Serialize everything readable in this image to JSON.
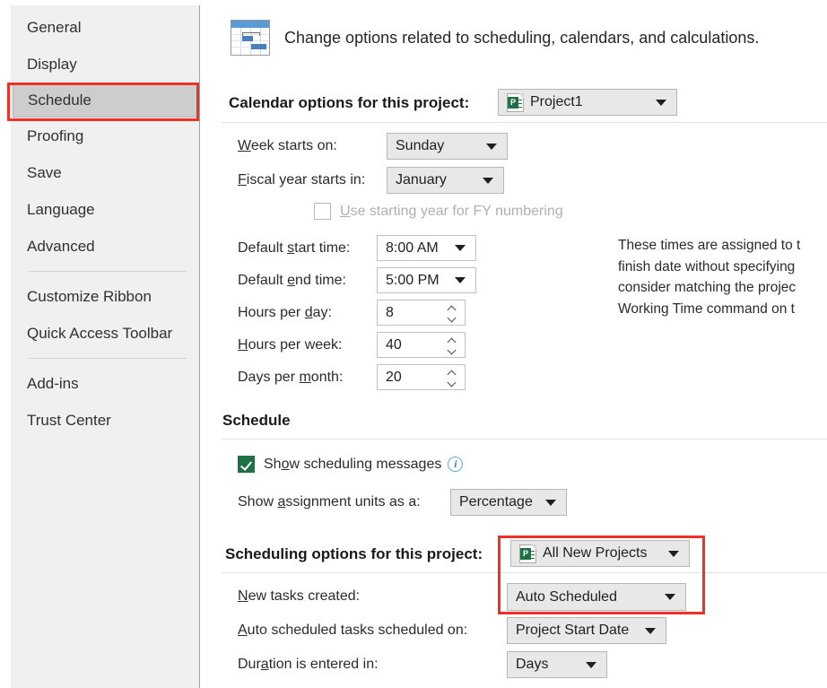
{
  "sidebar": {
    "items": [
      {
        "label": "General",
        "selected": false,
        "divider_after": false
      },
      {
        "label": "Display",
        "selected": false,
        "divider_after": false
      },
      {
        "label": "Schedule",
        "selected": true,
        "divider_after": false
      },
      {
        "label": "Proofing",
        "selected": false,
        "divider_after": false
      },
      {
        "label": "Save",
        "selected": false,
        "divider_after": false
      },
      {
        "label": "Language",
        "selected": false,
        "divider_after": false
      },
      {
        "label": "Advanced",
        "selected": false,
        "divider_after": true
      },
      {
        "label": "Customize Ribbon",
        "selected": false,
        "divider_after": false
      },
      {
        "label": "Quick Access Toolbar",
        "selected": false,
        "divider_after": true
      },
      {
        "label": "Add-ins",
        "selected": false,
        "divider_after": false
      },
      {
        "label": "Trust Center",
        "selected": false,
        "divider_after": false
      }
    ]
  },
  "header": {
    "icon": "gantt-chart-icon",
    "description": "Change options related to scheduling, calendars, and calculations."
  },
  "calendar_section": {
    "title": "Calendar options for this project:",
    "title_accesskey": "i",
    "project_selector": {
      "icon": "project-document-icon",
      "value": "Project1",
      "arrow": "chevron-down-icon"
    },
    "rows": [
      {
        "label_pre": "",
        "label_key": "W",
        "label_post": "eek starts on:",
        "value": "Sunday",
        "type": "combo-grey"
      },
      {
        "label_pre": "",
        "label_key": "F",
        "label_post": "iscal year starts in:",
        "value": "January",
        "type": "combo-grey"
      }
    ],
    "fy_checkbox": {
      "label_pre": "",
      "label_key": "U",
      "label_post": "se starting year for FY numbering",
      "checked": false,
      "disabled": true
    },
    "time_rows": [
      {
        "label_pre": "Default ",
        "label_key": "s",
        "label_post": "tart time:",
        "value": "8:00 AM",
        "type": "combo-white"
      },
      {
        "label_pre": "Default ",
        "label_key": "e",
        "label_post": "nd time:",
        "value": "5:00 PM",
        "type": "combo-white"
      },
      {
        "label_pre": "Hours per ",
        "label_key": "d",
        "label_post": "ay:",
        "value": "8",
        "type": "spinner"
      },
      {
        "label_pre": "",
        "label_key": "H",
        "label_post": "ours per week:",
        "value": "40",
        "type": "spinner"
      },
      {
        "label_pre": "Days per ",
        "label_key": "m",
        "label_post": "onth:",
        "value": "20",
        "type": "spinner"
      }
    ],
    "help_lines": [
      "These times are assigned to t",
      "finish date without specifying",
      "consider matching the projec",
      "Working Time command on t"
    ]
  },
  "schedule_section": {
    "title": "Schedule",
    "show_messages": {
      "label_pre": "Sh",
      "label_key": "o",
      "label_post": "w scheduling messages",
      "checked": true,
      "info_icon": "info-circle-icon"
    },
    "assignment_units": {
      "label_pre": "Show ",
      "label_key": "a",
      "label_post": "ssignment units as a:",
      "value": "Percentage"
    }
  },
  "scheduling_options_section": {
    "title": "Scheduling options for this project:",
    "title_key": "l",
    "project_selector": {
      "icon": "project-document-icon",
      "value": "All New Projects",
      "arrow": "chevron-down-icon"
    },
    "rows": [
      {
        "label_pre": "",
        "label_key": "N",
        "label_post": "ew tasks created:",
        "value": "Auto Scheduled"
      },
      {
        "label_pre": "",
        "label_key": "A",
        "label_post": "uto scheduled tasks scheduled on:",
        "value": "Project Start Date"
      },
      {
        "label_pre": "Dur",
        "label_key": "a",
        "label_post": "tion is entered in:",
        "value": "Days"
      }
    ]
  },
  "annotations": {
    "color": "#ee3124",
    "boxes": [
      {
        "name": "schedule-nav-highlight"
      },
      {
        "name": "scheduling-options-highlight"
      }
    ]
  }
}
